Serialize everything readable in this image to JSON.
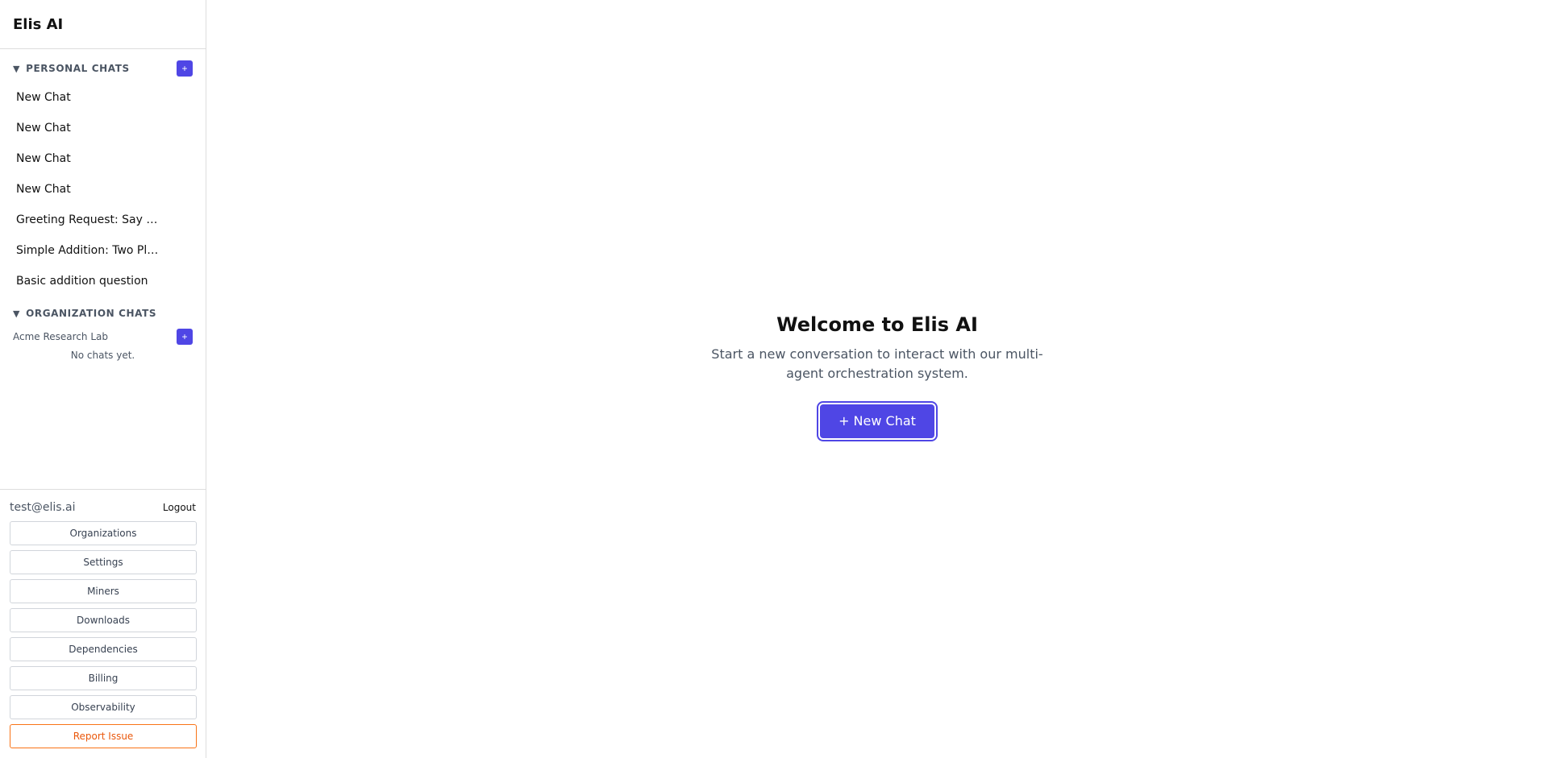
{
  "app": {
    "title": "Elis AI"
  },
  "sidebar": {
    "personal": {
      "title": "PERSONAL CHATS",
      "caret": "▼",
      "add_label": "+",
      "chats": [
        "New Chat",
        "New Chat",
        "New Chat",
        "New Chat",
        "Greeting Request: Say …",
        "Simple Addition: Two Pl…",
        "Basic addition question"
      ]
    },
    "organization": {
      "title": "ORGANIZATION CHATS",
      "caret": "▼",
      "orgs": [
        {
          "name": "Acme Research Lab",
          "add_label": "+",
          "empty": "No chats yet."
        }
      ]
    },
    "footer": {
      "email": "test@elis.ai",
      "logout": "Logout",
      "buttons": [
        "Organizations",
        "Settings",
        "Miners",
        "Downloads",
        "Dependencies",
        "Billing",
        "Observability"
      ],
      "report": "Report Issue"
    }
  },
  "main": {
    "heading": "Welcome to Elis AI",
    "subtitle": "Start a new conversation to interact with our multi-agent orchestration system.",
    "new_chat_button": "+ New Chat"
  },
  "colors": {
    "accent": "#4f46e5",
    "report": "#ea580c",
    "border": "#dddddd"
  }
}
